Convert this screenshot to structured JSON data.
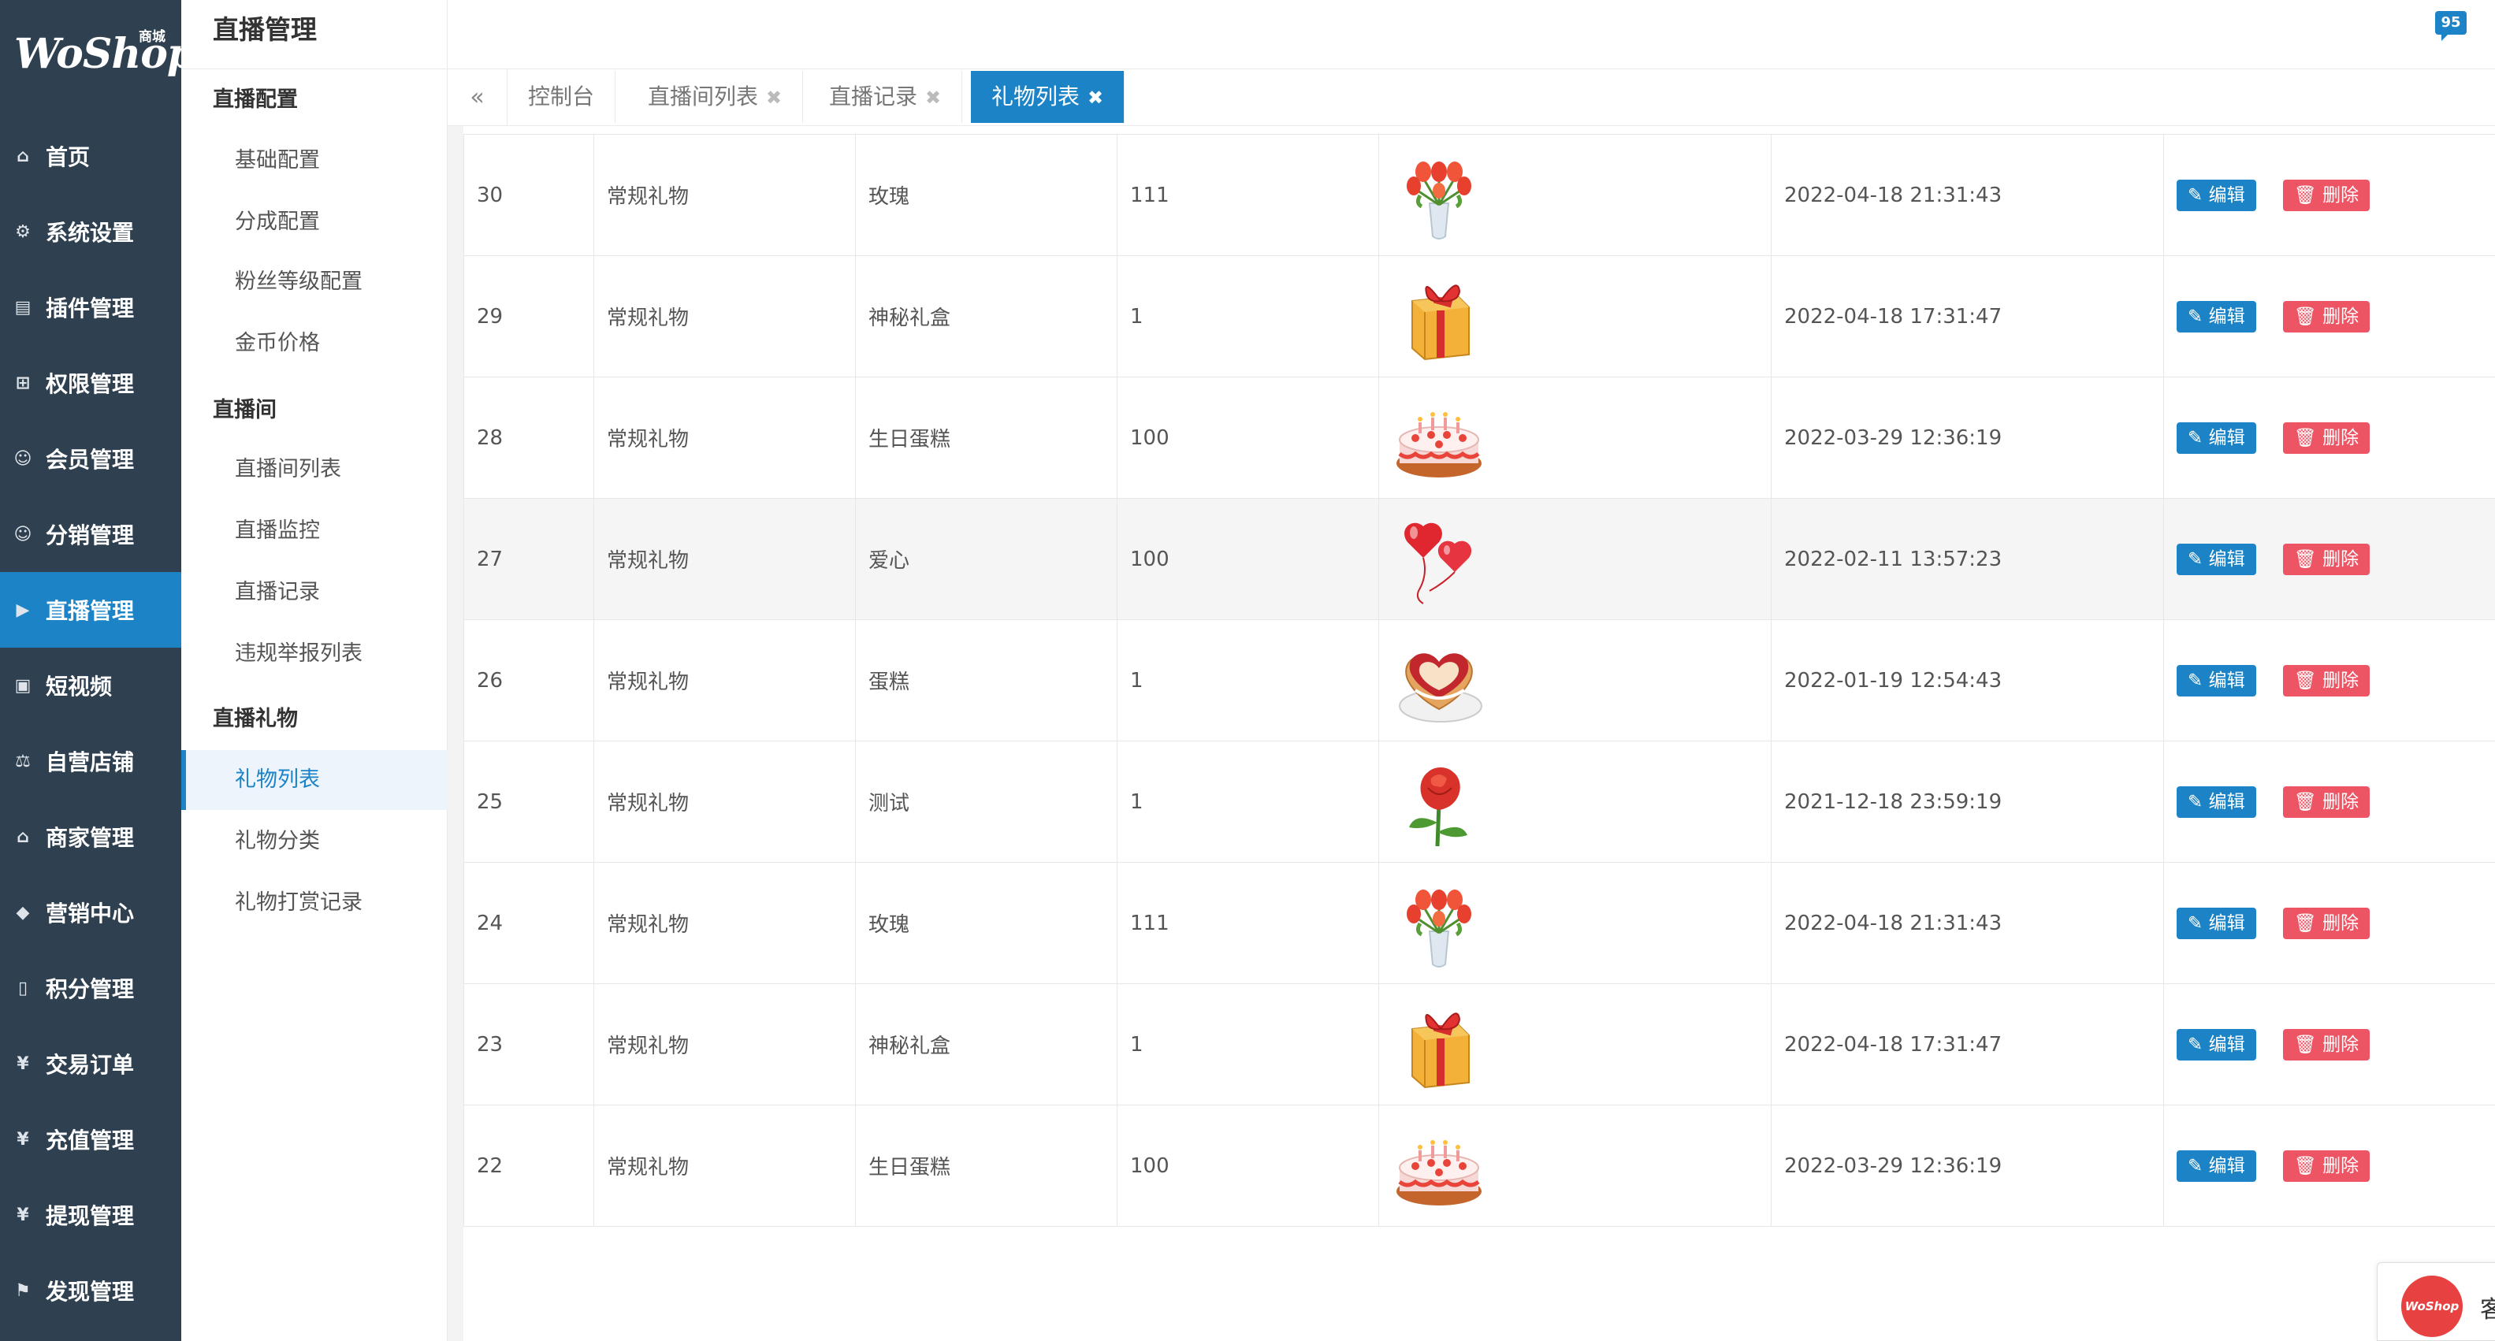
{
  "brand": {
    "logo": "WoShop",
    "sub": "商城"
  },
  "header": {
    "message_count": "95"
  },
  "nav": [
    {
      "label": "首页",
      "icon": "home-icon",
      "glyph": "⌂"
    },
    {
      "label": "系统设置",
      "icon": "gear-icon",
      "glyph": "⚙"
    },
    {
      "label": "插件管理",
      "icon": "plugin-icon",
      "glyph": "▤"
    },
    {
      "label": "权限管理",
      "icon": "sitemap-icon",
      "glyph": "⊞"
    },
    {
      "label": "会员管理",
      "icon": "users-icon",
      "glyph": "☺"
    },
    {
      "label": "分销管理",
      "icon": "share-users-icon",
      "glyph": "☺"
    },
    {
      "label": "直播管理",
      "icon": "video-camera-icon",
      "glyph": "▶",
      "active": true
    },
    {
      "label": "短视频",
      "icon": "film-icon",
      "glyph": "▣"
    },
    {
      "label": "自营店铺",
      "icon": "balance-icon",
      "glyph": "⚖"
    },
    {
      "label": "商家管理",
      "icon": "bank-icon",
      "glyph": "⌂"
    },
    {
      "label": "营销中心",
      "icon": "tag-icon",
      "glyph": "◆"
    },
    {
      "label": "积分管理",
      "icon": "file-icon",
      "glyph": "▯"
    },
    {
      "label": "交易订单",
      "icon": "yen-icon",
      "glyph": "¥"
    },
    {
      "label": "充值管理",
      "icon": "yen-icon",
      "glyph": "¥"
    },
    {
      "label": "提现管理",
      "icon": "yen-icon",
      "glyph": "¥"
    },
    {
      "label": "发现管理",
      "icon": "flag-icon",
      "glyph": "⚑"
    }
  ],
  "subnav": {
    "title": "直播管理",
    "groups": [
      {
        "label": "直播配置"
      },
      {
        "label": "直播间"
      },
      {
        "label": "直播礼物"
      }
    ],
    "items": [
      {
        "label": "基础配置"
      },
      {
        "label": "分成配置"
      },
      {
        "label": "粉丝等级配置"
      },
      {
        "label": "金币价格"
      },
      {
        "label": "直播间列表"
      },
      {
        "label": "直播监控"
      },
      {
        "label": "直播记录"
      },
      {
        "label": "违规举报列表"
      },
      {
        "label": "礼物列表",
        "active": true
      },
      {
        "label": "礼物分类"
      },
      {
        "label": "礼物打赏记录"
      }
    ]
  },
  "tabs": [
    {
      "label": "控制台",
      "closable": false
    },
    {
      "label": "直播间列表",
      "closable": true
    },
    {
      "label": "直播记录",
      "closable": true
    },
    {
      "label": "礼物列表",
      "closable": true,
      "active": true
    }
  ],
  "table": {
    "edit_label": "编辑",
    "delete_label": "删除",
    "rows": [
      {
        "id": "30",
        "category": "常规礼物",
        "name": "玫瑰",
        "price": "111",
        "image": "tulip-vase",
        "time": "2022-04-18 21:31:43"
      },
      {
        "id": "29",
        "category": "常规礼物",
        "name": "神秘礼盒",
        "price": "1",
        "image": "gift-box",
        "time": "2022-04-18 17:31:47"
      },
      {
        "id": "28",
        "category": "常规礼物",
        "name": "生日蛋糕",
        "price": "100",
        "image": "birthday-cake",
        "time": "2022-03-29 12:36:19"
      },
      {
        "id": "27",
        "category": "常规礼物",
        "name": "爱心",
        "price": "100",
        "image": "heart-balloons",
        "time": "2022-02-11 13:57:23",
        "highlight": true
      },
      {
        "id": "26",
        "category": "常规礼物",
        "name": "蛋糕",
        "price": "1",
        "image": "heart-cake",
        "time": "2022-01-19 12:54:43"
      },
      {
        "id": "25",
        "category": "常规礼物",
        "name": "测试",
        "price": "1",
        "image": "rose",
        "time": "2021-12-18 23:59:19"
      },
      {
        "id": "24",
        "category": "常规礼物",
        "name": "玫瑰",
        "price": "111",
        "image": "tulip-vase",
        "time": "2022-04-18 21:31:43"
      },
      {
        "id": "23",
        "category": "常规礼物",
        "name": "神秘礼盒",
        "price": "1",
        "image": "gift-box",
        "time": "2022-04-18 17:31:47"
      },
      {
        "id": "22",
        "category": "常规礼物",
        "name": "生日蛋糕",
        "price": "100",
        "image": "birthday-cake",
        "time": "2022-03-29 12:36:19"
      }
    ]
  },
  "customer_service": {
    "logo": "WoShop",
    "label": "客"
  }
}
